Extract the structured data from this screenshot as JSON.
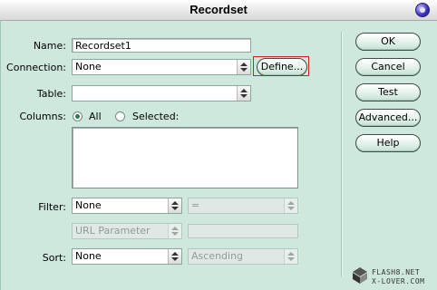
{
  "window": {
    "title": "Recordset"
  },
  "form": {
    "name_label": "Name:",
    "name_value": "Recordset1",
    "connection_label": "Connection:",
    "connection_value": "None",
    "define_button": "Define...",
    "table_label": "Table:",
    "table_value": "",
    "columns_label": "Columns:",
    "columns_all": "All",
    "columns_selected": "Selected:",
    "columns_selected_state": "All",
    "filter_label": "Filter:",
    "filter_value": "None",
    "filter_operator": "=",
    "filter_param": "URL Parameter",
    "filter_param_value": "",
    "sort_label": "Sort:",
    "sort_value": "None",
    "sort_order": "Ascending"
  },
  "buttons": {
    "ok": "OK",
    "cancel": "Cancel",
    "test": "Test",
    "advanced": "Advanced...",
    "help": "Help"
  },
  "watermark": {
    "line1": "FLASH8.NET",
    "line2": "X-LOVER.COM"
  },
  "colors": {
    "background": "#cfe8de",
    "accent_border": "#cc2222"
  },
  "icons": {
    "close": "close-icon"
  }
}
